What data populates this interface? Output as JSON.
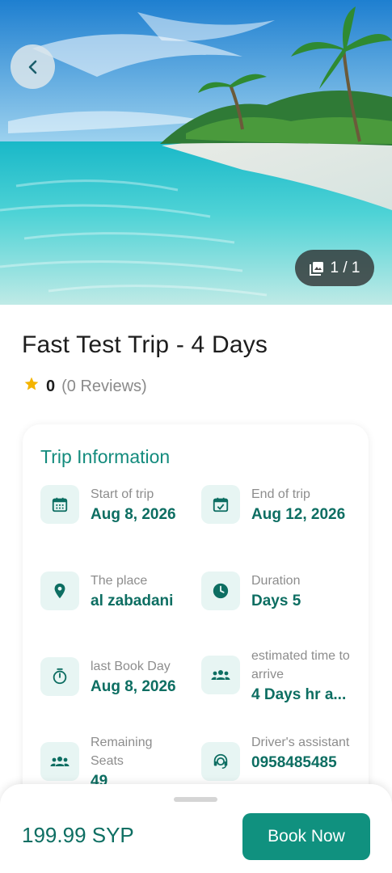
{
  "gallery": {
    "counter": "1 / 1",
    "counter_icon": "image-stack-icon",
    "back_icon": "chevron-left-icon"
  },
  "trip": {
    "title": "Fast Test Trip - 4 Days",
    "rating": "0",
    "reviews": "(0 Reviews)"
  },
  "info": {
    "heading": "Trip Information",
    "items": [
      {
        "label": "Start of trip",
        "value": "Aug 8, 2026",
        "icon": "calendar-icon"
      },
      {
        "label": "End of trip",
        "value": "Aug 12, 2026",
        "icon": "calendar-check-icon"
      },
      {
        "label": "The place",
        "value": "al zabadani",
        "icon": "location-pin-icon"
      },
      {
        "label": "Duration",
        "value": "Days 5",
        "icon": "clock-icon"
      },
      {
        "label": "last Book Day",
        "value": "Aug 8, 2026",
        "icon": "stopwatch-icon"
      },
      {
        "label": "estimated time to arrive",
        "value": "4 Days hr a...",
        "icon": "group-icon"
      },
      {
        "label": "Remaining Seats",
        "value": "49",
        "icon": "group-icon"
      },
      {
        "label": "Driver's assistant",
        "value": "0958485485",
        "icon": "support-agent-icon"
      }
    ]
  },
  "footer": {
    "price": "199.99 SYP",
    "book_label": "Book Now"
  },
  "colors": {
    "accent": "#10917f",
    "accent_text": "#0d6e62",
    "icon_bg": "#e7f5f3",
    "star": "#f4b400"
  }
}
